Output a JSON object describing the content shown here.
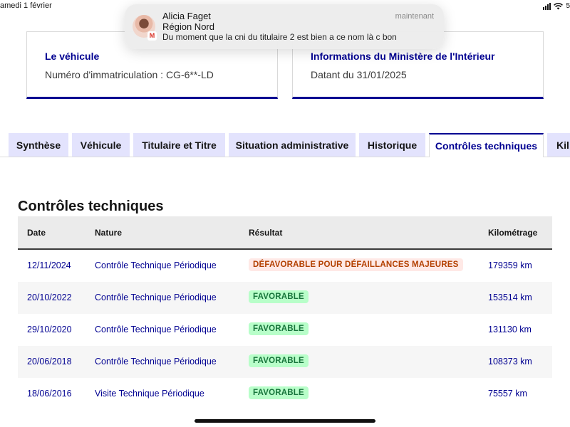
{
  "status_bar": {
    "date": "amedi 1 février",
    "battery_fragment": "5"
  },
  "notification": {
    "sender": "Alicia Faget",
    "subject": "Région Nord",
    "body": "Du moment que la cni du titulaire 2 est bien a ce nom là c bon",
    "time": "maintenant",
    "app_icon": "gmail-icon",
    "app_badge_letter": "M"
  },
  "cards": {
    "vehicle": {
      "title": "Le véhicule",
      "text": "Numéro d'immatriculation : CG-6**-LD"
    },
    "ministry": {
      "title": "Informations du Ministère de l'Intérieur",
      "text": "Datant du 31/01/2025"
    }
  },
  "tabs": [
    {
      "label": "Synthèse",
      "active": false
    },
    {
      "label": "Véhicule",
      "active": false
    },
    {
      "label": "Titulaire et Titre",
      "active": false
    },
    {
      "label": "Situation administrative",
      "active": false
    },
    {
      "label": "Historique",
      "active": false
    },
    {
      "label": "Contrôles techniques",
      "active": true
    },
    {
      "label": "Kil",
      "active": false
    }
  ],
  "section": {
    "title": "Contrôles techniques"
  },
  "table": {
    "headers": [
      "Date",
      "Nature",
      "Résultat",
      "Kilométrage"
    ],
    "rows": [
      {
        "date": "12/11/2024",
        "nature": "Contrôle Technique Périodique",
        "result": "DÉFAVORABLE POUR DÉFAILLANCES MAJEURES",
        "result_status": "unfavorable",
        "km": "179359 km"
      },
      {
        "date": "20/10/2022",
        "nature": "Contrôle Technique Périodique",
        "result": "FAVORABLE",
        "result_status": "favorable",
        "km": "153514 km"
      },
      {
        "date": "29/10/2020",
        "nature": "Contrôle Technique Périodique",
        "result": "FAVORABLE",
        "result_status": "favorable",
        "km": "131130 km"
      },
      {
        "date": "20/06/2018",
        "nature": "Contrôle Technique Périodique",
        "result": "FAVORABLE",
        "result_status": "favorable",
        "km": "108373 km"
      },
      {
        "date": "18/06/2016",
        "nature": "Visite Technique Périodique",
        "result": "FAVORABLE",
        "result_status": "favorable",
        "km": "75557 km"
      }
    ]
  },
  "colors": {
    "brand_blue": "#000091",
    "tab_inactive_bg": "#e3e3fd",
    "favorable_bg": "#b8fec9",
    "favorable_text": "#18753c",
    "unfavorable_bg": "#ffe9e6",
    "unfavorable_text": "#b34000"
  }
}
